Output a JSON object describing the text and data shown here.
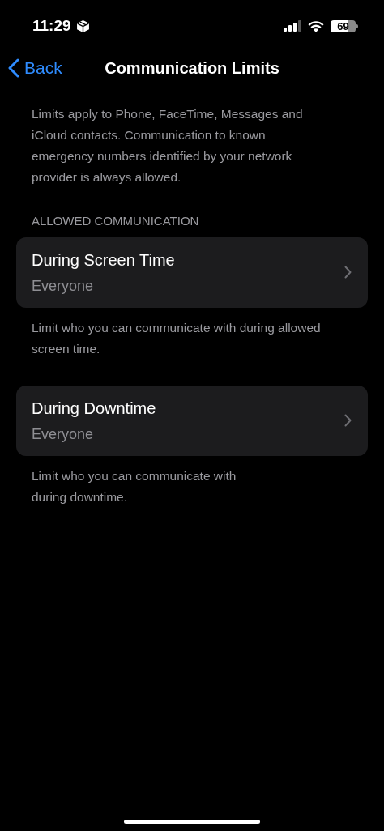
{
  "status_bar": {
    "time": "11:29",
    "battery": "69"
  },
  "nav": {
    "back": "Back",
    "title": "Communication Limits"
  },
  "description": "Limits apply to Phone, FaceTime, Messages and\niCloud contacts. Communication to known\nemergency numbers identified by your network\nprovider is always allowed.",
  "section_header": "ALLOWED COMMUNICATION",
  "groups": [
    {
      "title": "During Screen Time",
      "value": "Everyone",
      "footer": "Limit who you can communicate with during allowed\nscreen time."
    },
    {
      "title": "During Downtime",
      "value": "Everyone",
      "footer": "Limit who you can communicate with\nduring downtime."
    }
  ]
}
